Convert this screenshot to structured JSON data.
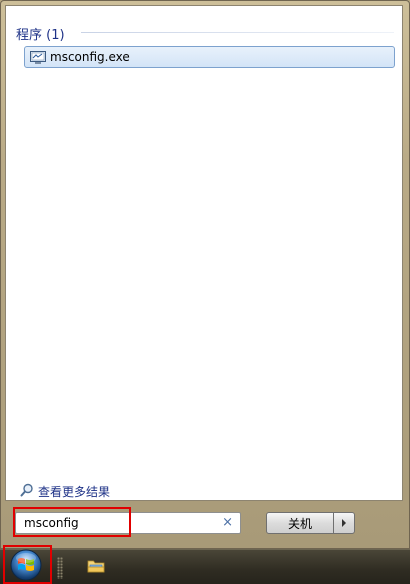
{
  "programs_section": {
    "header": "程序 (1)",
    "results": [
      {
        "label": "msconfig.exe",
        "icon": "msconfig-app-icon"
      }
    ]
  },
  "see_more": {
    "label": "查看更多结果",
    "icon": "magnifier-icon"
  },
  "search": {
    "value": "msconfig",
    "clear_icon": "×"
  },
  "shutdown": {
    "label": "关机",
    "arrow_icon": "chevron-right-icon"
  },
  "taskbar": {
    "start_icon": "windows-orb-icon",
    "pinned": [
      {
        "name": "windows-explorer",
        "icon": "folder-icon"
      }
    ]
  },
  "colors": {
    "highlight": "#e00000",
    "header_text": "#1e3287",
    "selection_border": "#7da2ce"
  }
}
